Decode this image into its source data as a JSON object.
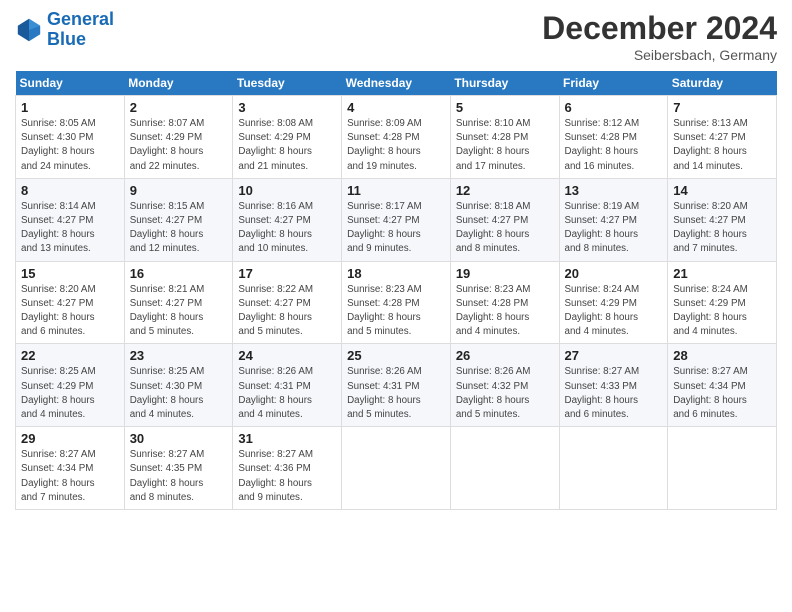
{
  "header": {
    "logo_line1": "General",
    "logo_line2": "Blue",
    "month_title": "December 2024",
    "location": "Seibersbach, Germany"
  },
  "days_of_week": [
    "Sunday",
    "Monday",
    "Tuesday",
    "Wednesday",
    "Thursday",
    "Friday",
    "Saturday"
  ],
  "weeks": [
    [
      {
        "day": "1",
        "info": "Sunrise: 8:05 AM\nSunset: 4:30 PM\nDaylight: 8 hours\nand 24 minutes."
      },
      {
        "day": "2",
        "info": "Sunrise: 8:07 AM\nSunset: 4:29 PM\nDaylight: 8 hours\nand 22 minutes."
      },
      {
        "day": "3",
        "info": "Sunrise: 8:08 AM\nSunset: 4:29 PM\nDaylight: 8 hours\nand 21 minutes."
      },
      {
        "day": "4",
        "info": "Sunrise: 8:09 AM\nSunset: 4:28 PM\nDaylight: 8 hours\nand 19 minutes."
      },
      {
        "day": "5",
        "info": "Sunrise: 8:10 AM\nSunset: 4:28 PM\nDaylight: 8 hours\nand 17 minutes."
      },
      {
        "day": "6",
        "info": "Sunrise: 8:12 AM\nSunset: 4:28 PM\nDaylight: 8 hours\nand 16 minutes."
      },
      {
        "day": "7",
        "info": "Sunrise: 8:13 AM\nSunset: 4:27 PM\nDaylight: 8 hours\nand 14 minutes."
      }
    ],
    [
      {
        "day": "8",
        "info": "Sunrise: 8:14 AM\nSunset: 4:27 PM\nDaylight: 8 hours\nand 13 minutes."
      },
      {
        "day": "9",
        "info": "Sunrise: 8:15 AM\nSunset: 4:27 PM\nDaylight: 8 hours\nand 12 minutes."
      },
      {
        "day": "10",
        "info": "Sunrise: 8:16 AM\nSunset: 4:27 PM\nDaylight: 8 hours\nand 10 minutes."
      },
      {
        "day": "11",
        "info": "Sunrise: 8:17 AM\nSunset: 4:27 PM\nDaylight: 8 hours\nand 9 minutes."
      },
      {
        "day": "12",
        "info": "Sunrise: 8:18 AM\nSunset: 4:27 PM\nDaylight: 8 hours\nand 8 minutes."
      },
      {
        "day": "13",
        "info": "Sunrise: 8:19 AM\nSunset: 4:27 PM\nDaylight: 8 hours\nand 8 minutes."
      },
      {
        "day": "14",
        "info": "Sunrise: 8:20 AM\nSunset: 4:27 PM\nDaylight: 8 hours\nand 7 minutes."
      }
    ],
    [
      {
        "day": "15",
        "info": "Sunrise: 8:20 AM\nSunset: 4:27 PM\nDaylight: 8 hours\nand 6 minutes."
      },
      {
        "day": "16",
        "info": "Sunrise: 8:21 AM\nSunset: 4:27 PM\nDaylight: 8 hours\nand 5 minutes."
      },
      {
        "day": "17",
        "info": "Sunrise: 8:22 AM\nSunset: 4:27 PM\nDaylight: 8 hours\nand 5 minutes."
      },
      {
        "day": "18",
        "info": "Sunrise: 8:23 AM\nSunset: 4:28 PM\nDaylight: 8 hours\nand 5 minutes."
      },
      {
        "day": "19",
        "info": "Sunrise: 8:23 AM\nSunset: 4:28 PM\nDaylight: 8 hours\nand 4 minutes."
      },
      {
        "day": "20",
        "info": "Sunrise: 8:24 AM\nSunset: 4:29 PM\nDaylight: 8 hours\nand 4 minutes."
      },
      {
        "day": "21",
        "info": "Sunrise: 8:24 AM\nSunset: 4:29 PM\nDaylight: 8 hours\nand 4 minutes."
      }
    ],
    [
      {
        "day": "22",
        "info": "Sunrise: 8:25 AM\nSunset: 4:29 PM\nDaylight: 8 hours\nand 4 minutes."
      },
      {
        "day": "23",
        "info": "Sunrise: 8:25 AM\nSunset: 4:30 PM\nDaylight: 8 hours\nand 4 minutes."
      },
      {
        "day": "24",
        "info": "Sunrise: 8:26 AM\nSunset: 4:31 PM\nDaylight: 8 hours\nand 4 minutes."
      },
      {
        "day": "25",
        "info": "Sunrise: 8:26 AM\nSunset: 4:31 PM\nDaylight: 8 hours\nand 5 minutes."
      },
      {
        "day": "26",
        "info": "Sunrise: 8:26 AM\nSunset: 4:32 PM\nDaylight: 8 hours\nand 5 minutes."
      },
      {
        "day": "27",
        "info": "Sunrise: 8:27 AM\nSunset: 4:33 PM\nDaylight: 8 hours\nand 6 minutes."
      },
      {
        "day": "28",
        "info": "Sunrise: 8:27 AM\nSunset: 4:34 PM\nDaylight: 8 hours\nand 6 minutes."
      }
    ],
    [
      {
        "day": "29",
        "info": "Sunrise: 8:27 AM\nSunset: 4:34 PM\nDaylight: 8 hours\nand 7 minutes."
      },
      {
        "day": "30",
        "info": "Sunrise: 8:27 AM\nSunset: 4:35 PM\nDaylight: 8 hours\nand 8 minutes."
      },
      {
        "day": "31",
        "info": "Sunrise: 8:27 AM\nSunset: 4:36 PM\nDaylight: 8 hours\nand 9 minutes."
      },
      null,
      null,
      null,
      null
    ]
  ]
}
